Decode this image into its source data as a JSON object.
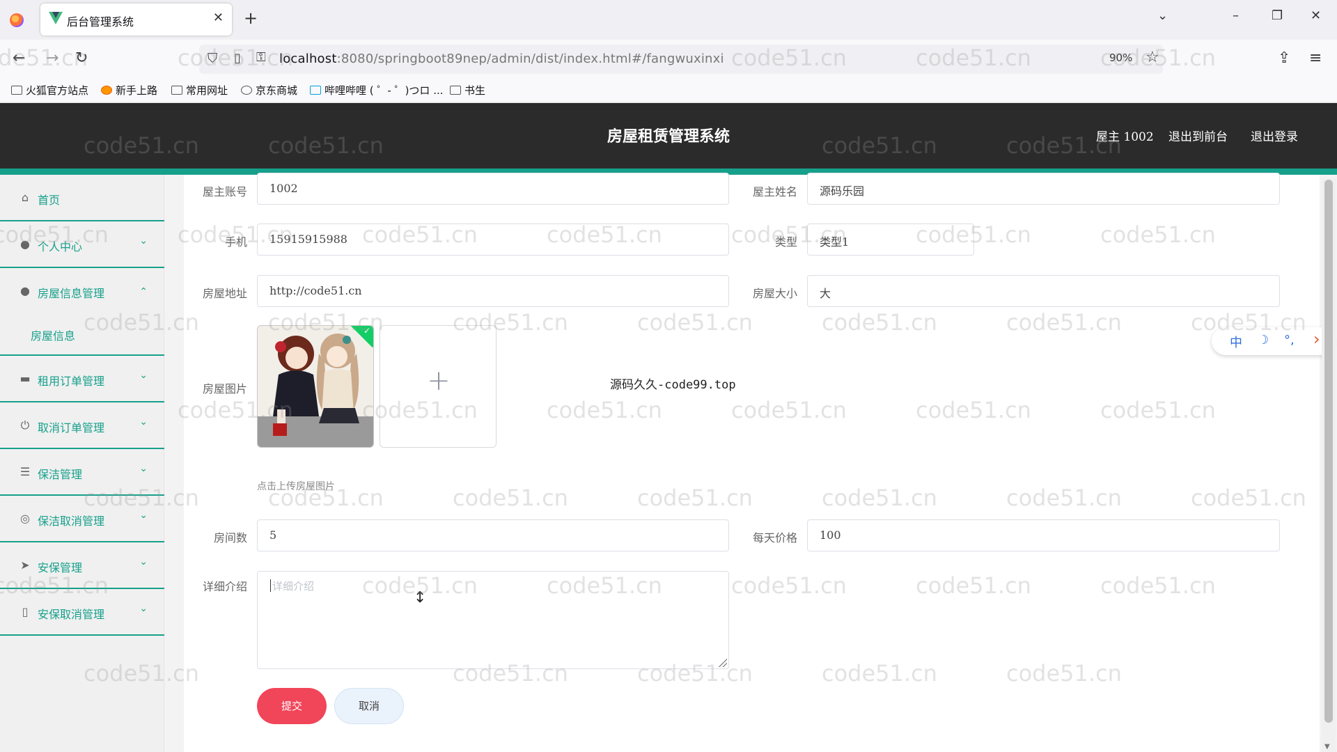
{
  "browser": {
    "tab_title": "后台管理系统",
    "tab_close": "✕",
    "new_tab": "+",
    "url_host": "localhost",
    "url_rest": ":8080/springboot89nep/admin/dist/index.html#/fangwuxinxi",
    "zoom": "90%",
    "bookmarks": [
      "火狐官方站点",
      "新手上路",
      "常用网址",
      "京东商城",
      "哔哩哔哩 ( ゜- ゜)つロ ...",
      "书生"
    ]
  },
  "header": {
    "title": "房屋租赁管理系统",
    "user": "屋主 1002",
    "to_front": "退出到前台",
    "logout": "退出登录"
  },
  "sidebar": {
    "items": [
      {
        "label": "首页",
        "icon": "home-icon",
        "glyph": "⌂"
      },
      {
        "label": "个人中心",
        "icon": "user-icon",
        "glyph": "●",
        "arrow": "⌄"
      },
      {
        "label": "房屋信息管理",
        "icon": "user-icon",
        "glyph": "●",
        "arrow": "⌃"
      },
      {
        "label": "租用订单管理",
        "icon": "briefcase-icon",
        "glyph": "▬",
        "arrow": "⌄"
      },
      {
        "label": "取消订单管理",
        "icon": "power-icon",
        "glyph": "⏻",
        "arrow": "⌄"
      },
      {
        "label": "保洁管理",
        "icon": "list-icon",
        "glyph": "☰",
        "arrow": "⌄"
      },
      {
        "label": "保洁取消管理",
        "icon": "compass-icon",
        "glyph": "◎",
        "arrow": "⌄"
      },
      {
        "label": "安保管理",
        "icon": "send-icon",
        "glyph": "➤",
        "arrow": "⌄"
      },
      {
        "label": "安保取消管理",
        "icon": "mobile-icon",
        "glyph": "▯",
        "arrow": "⌄"
      }
    ],
    "sub_item": "房屋信息"
  },
  "form": {
    "owner_account_label": "屋主账号",
    "owner_account": "1002",
    "owner_name_label": "屋主姓名",
    "owner_name": "源码乐园",
    "phone_label": "手机",
    "phone": "15915915988",
    "type_label": "类型",
    "type": "类型1",
    "address_label": "房屋地址",
    "address": "http://code51.cn",
    "size_label": "房屋大小",
    "size": "大",
    "image_label": "房屋图片",
    "upload_tip": "点击上传房屋图片",
    "upload_plus": "+",
    "promo_text": "源码久久-code99.top",
    "rooms_label": "房间数",
    "rooms": "5",
    "price_label": "每天价格",
    "price": "100",
    "detail_label": "详细介绍",
    "detail_placeholder": "详细介绍",
    "submit": "提交",
    "cancel": "取消"
  },
  "ime": {
    "zh": "中",
    "moon": "☽",
    "dots": "°,",
    "arrow": "›"
  },
  "watermark_text": "code51.cn",
  "colors": {
    "accent": "#16a08b",
    "header_bg": "#2b2b2b",
    "submit_bg": "#f14559",
    "cancel_bg": "#eaf2fb"
  }
}
